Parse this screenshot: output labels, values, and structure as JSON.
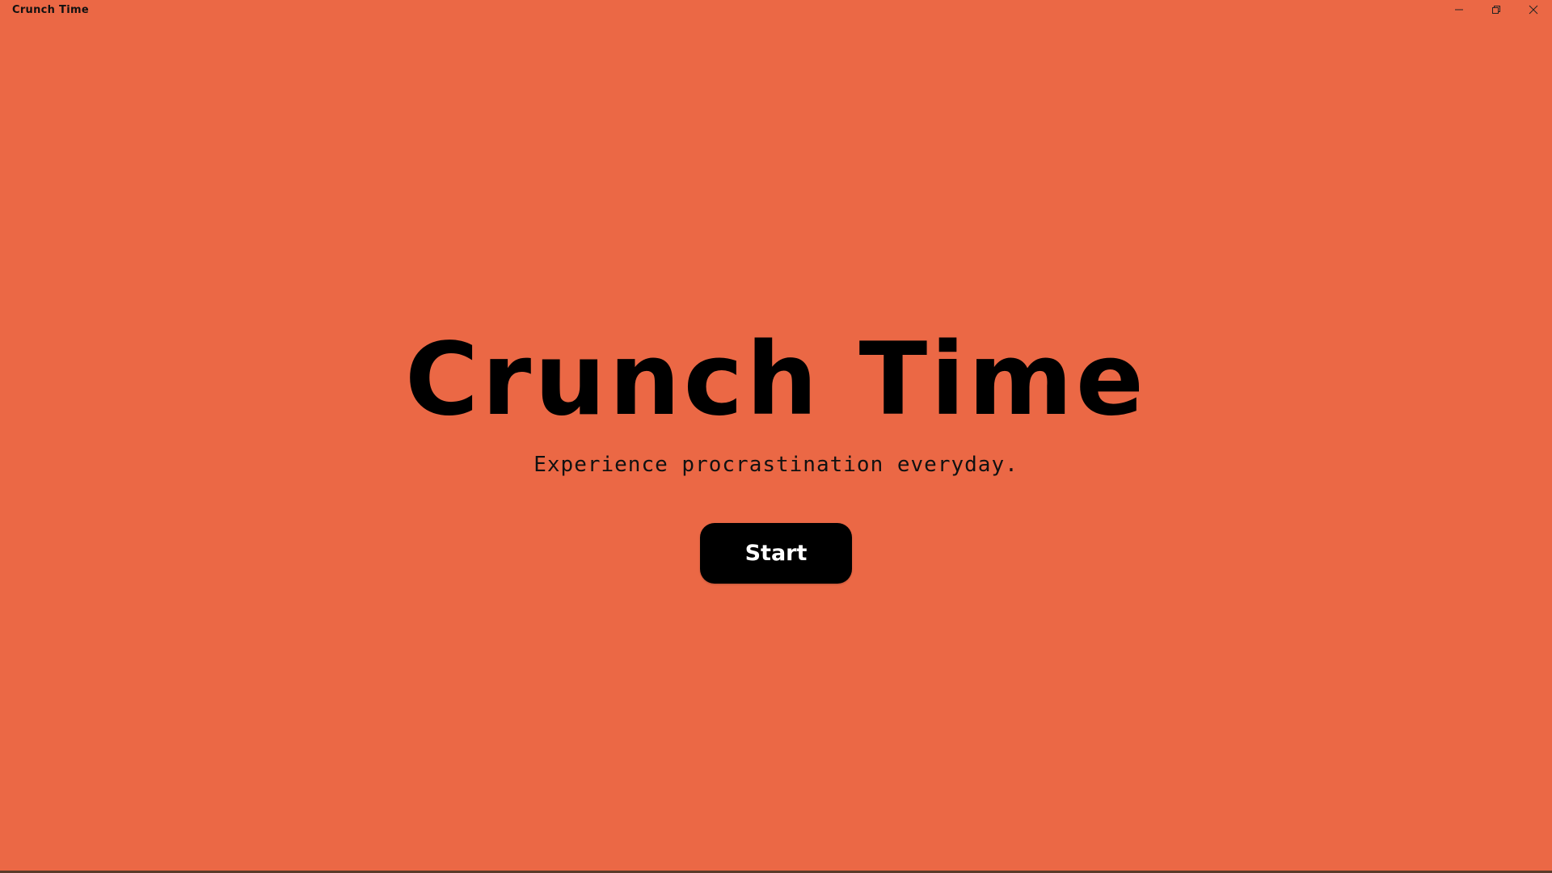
{
  "window": {
    "title": "Crunch Time",
    "controls": [
      "minimize-icon",
      "restore-icon",
      "close-icon"
    ]
  },
  "main": {
    "title": "Crunch Time",
    "tagline": "Experience procrastination everyday.",
    "start_label": "Start"
  },
  "colors": {
    "background": "#EB6845",
    "text": "#000000",
    "button_background": "#000000",
    "button_text": "#FFFFFF"
  }
}
